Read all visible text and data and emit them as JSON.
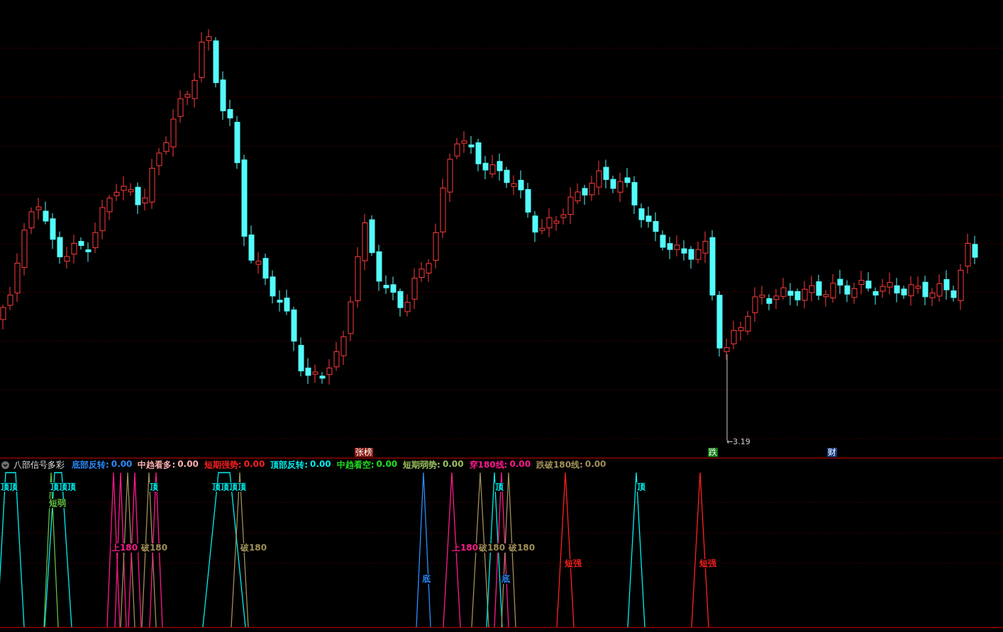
{
  "price_chart": {
    "low_marker": "←3.19",
    "events": [
      {
        "label": "张榜",
        "color": "#8b1e14"
      },
      {
        "label": "跌",
        "color": "#0f7a12"
      },
      {
        "label": "财",
        "color": "#163c80"
      }
    ]
  },
  "indicator": {
    "name": "八部信号多彩",
    "fields": [
      {
        "label": "底部反转:",
        "value": "0.00",
        "color": "#2b8cff"
      },
      {
        "label": "中趋看多:",
        "value": "0.00",
        "color": "#ffb0b0"
      },
      {
        "label": "短期强势:",
        "value": "0.00",
        "color": "#ff2020"
      },
      {
        "label": "顶部反转:",
        "value": "0.00",
        "color": "#00f0f0"
      },
      {
        "label": "中趋看空:",
        "value": "0.00",
        "color": "#20e020"
      },
      {
        "label": "短期弱势:",
        "value": "0.00",
        "color": "#9cc060"
      },
      {
        "label": "穿180线:",
        "value": "0.00",
        "color": "#ff1a8c"
      },
      {
        "label": "跌破180线:",
        "value": "0.00",
        "color": "#a09058"
      }
    ]
  },
  "signals": [
    {
      "text": "顶顶",
      "color": "#00f0f0"
    },
    {
      "text": "顶顶顶",
      "color": "#00f0f0"
    },
    {
      "text": "短弱",
      "color": "#60c040"
    },
    {
      "text": "顶",
      "color": "#00f0f0"
    },
    {
      "text": "顶顶顶顶",
      "color": "#00f0f0"
    },
    {
      "text": "上180",
      "color": "#ff1a8c"
    },
    {
      "text": "破180",
      "color": "#a09058"
    },
    {
      "text": "破180",
      "color": "#a09058"
    },
    {
      "text": "底",
      "color": "#2b8cff"
    },
    {
      "text": "上180",
      "color": "#ff1a8c"
    },
    {
      "text": "顶",
      "color": "#00f0f0"
    },
    {
      "text": "破180",
      "color": "#a09058"
    },
    {
      "text": "破180",
      "color": "#a09058"
    },
    {
      "text": "底",
      "color": "#2b8cff"
    },
    {
      "text": "短强",
      "color": "#ff2020"
    },
    {
      "text": "顶",
      "color": "#00f0f0"
    },
    {
      "text": "短强",
      "color": "#ff2020"
    }
  ]
}
